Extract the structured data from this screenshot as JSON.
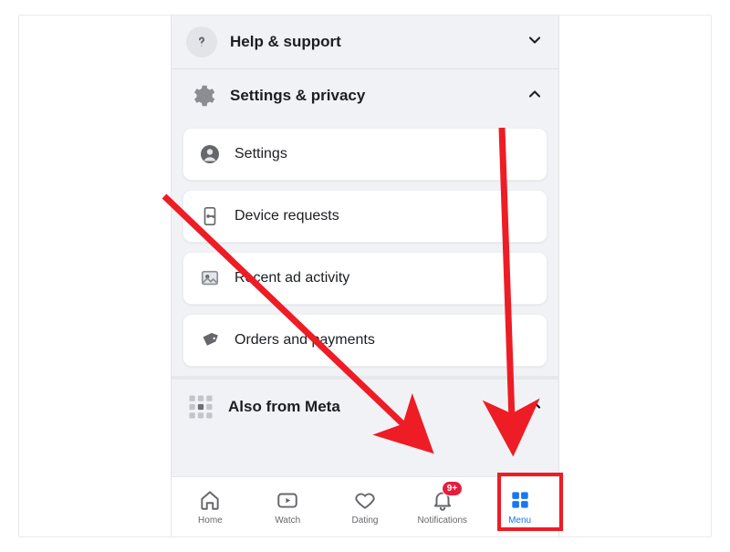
{
  "sections": {
    "help": {
      "label": "Help & support"
    },
    "settings_privacy": {
      "label": "Settings & privacy"
    },
    "also_from_meta": {
      "label": "Also from Meta"
    }
  },
  "settings_items": [
    {
      "label": "Settings"
    },
    {
      "label": "Device requests"
    },
    {
      "label": "Recent ad activity"
    },
    {
      "label": "Orders and payments"
    }
  ],
  "tabs": {
    "home": {
      "label": "Home"
    },
    "watch": {
      "label": "Watch"
    },
    "dating": {
      "label": "Dating"
    },
    "notifications": {
      "label": "Notifications",
      "badge": "9+"
    },
    "menu": {
      "label": "Menu"
    }
  },
  "colors": {
    "accent": "#1877f2",
    "annotation": "#ee1c25",
    "badge": "#e41e3f"
  }
}
